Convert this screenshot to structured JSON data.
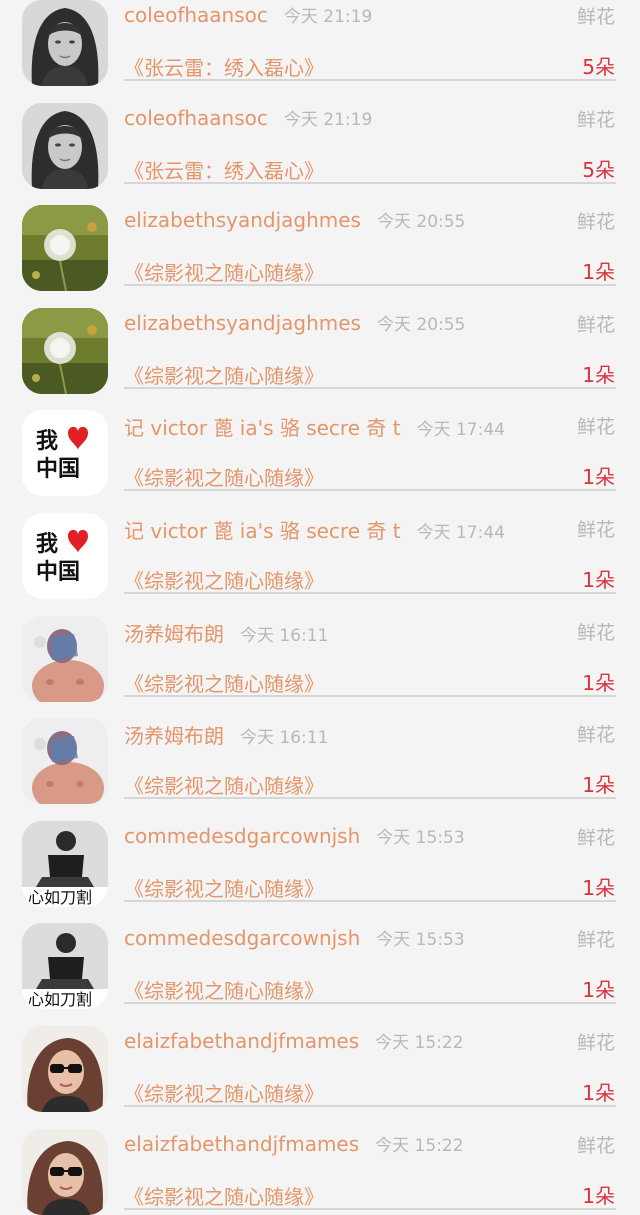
{
  "gift_list": [
    {
      "username": "coleofhaansoc",
      "time": "今天 21:19",
      "gift_type": "鲜花",
      "book": "《张云雷：绣入磊心》",
      "quantity": "5朵",
      "avatar": "woman-portrait-bw"
    },
    {
      "username": "coleofhaansoc",
      "time": "今天 21:19",
      "gift_type": "鲜花",
      "book": "《张云雷：绣入磊心》",
      "quantity": "5朵",
      "avatar": "woman-portrait-bw"
    },
    {
      "username": "elizabethsyandjaghmes",
      "time": "今天 20:55",
      "gift_type": "鲜花",
      "book": "《综影视之随心随缘》",
      "quantity": "1朵",
      "avatar": "dandelion"
    },
    {
      "username": "elizabethsyandjaghmes",
      "time": "今天 20:55",
      "gift_type": "鲜花",
      "book": "《综影视之随心随缘》",
      "quantity": "1朵",
      "avatar": "dandelion"
    },
    {
      "username": "记 victor 蓖 ia's 骆 secre 奇 t",
      "time": "今天 17:44",
      "gift_type": "鲜花",
      "book": "《综影视之随心随缘》",
      "quantity": "1朵",
      "avatar": "i-love-china"
    },
    {
      "username": "记 victor 蓖 ia's 骆 secre 奇 t",
      "time": "今天 17:44",
      "gift_type": "鲜花",
      "book": "《综影视之随心随缘》",
      "quantity": "1朵",
      "avatar": "i-love-china"
    },
    {
      "username": "汤养姆布朗",
      "time": "今天 16:11",
      "gift_type": "鲜花",
      "book": "《综影视之随心随缘》",
      "quantity": "1朵",
      "avatar": "shirtless-man"
    },
    {
      "username": "汤养姆布朗",
      "time": "今天 16:11",
      "gift_type": "鲜花",
      "book": "《综影视之随心随缘》",
      "quantity": "1朵",
      "avatar": "shirtless-man"
    },
    {
      "username": "commedesdgarcownjsh",
      "time": "今天 15:53",
      "gift_type": "鲜花",
      "book": "《综影视之随心随缘》",
      "quantity": "1朵",
      "avatar": "sitting-person-bw",
      "avatar_caption": "心如刀割"
    },
    {
      "username": "commedesdgarcownjsh",
      "time": "今天 15:53",
      "gift_type": "鲜花",
      "book": "《综影视之随心随缘》",
      "quantity": "1朵",
      "avatar": "sitting-person-bw",
      "avatar_caption": "心如刀割"
    },
    {
      "username": "elaizfabethandjfmames",
      "time": "今天 15:22",
      "gift_type": "鲜花",
      "book": "《综影视之随心随缘》",
      "quantity": "1朵",
      "avatar": "woman-sunglasses"
    },
    {
      "username": "elaizfabethandjfmames",
      "time": "今天 15:22",
      "gift_type": "鲜花",
      "book": "《综影视之随心随缘》",
      "quantity": "1朵",
      "avatar": "woman-sunglasses"
    }
  ],
  "colors": {
    "background": "#f5f4f5",
    "name_text": "#e2966a",
    "time_text": "#b8b8b8",
    "quantity_text": "#d9333f",
    "divider": "#d6d6d6"
  }
}
